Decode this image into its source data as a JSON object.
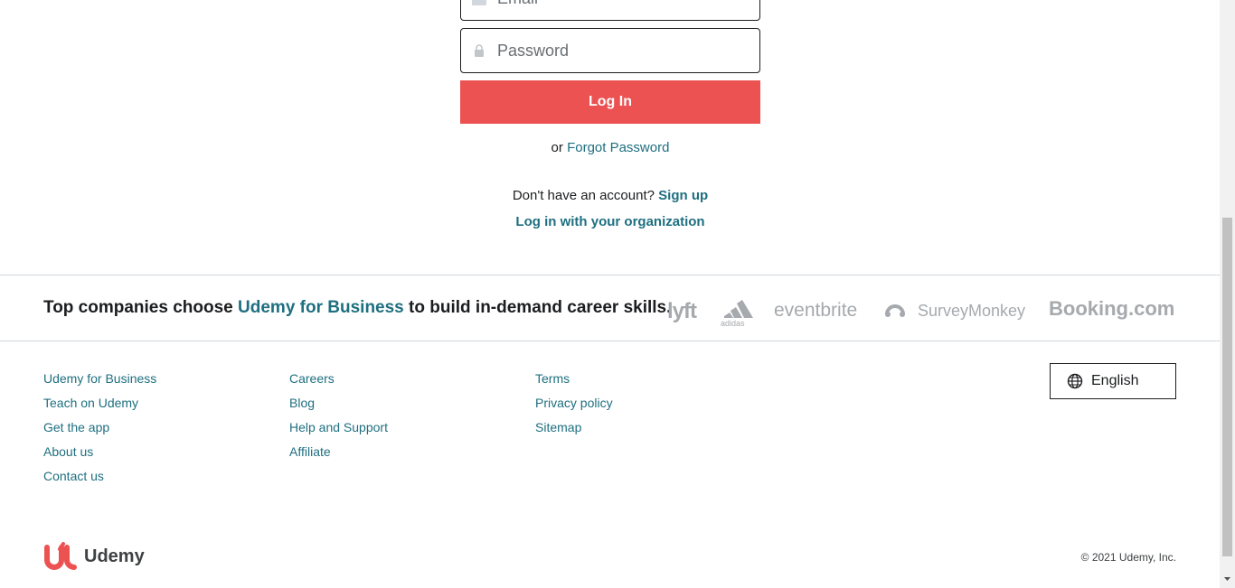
{
  "form": {
    "email_placeholder": "Email",
    "password_placeholder": "Password",
    "login_label": "Log In",
    "or_text": "or",
    "forgot_label": "Forgot Password",
    "no_account_text": "Don't have an account?",
    "signup_label": "Sign up",
    "org_login_label": "Log in with your organization",
    "icons": [
      "mail-icon",
      "lock-icon"
    ]
  },
  "business": {
    "text_before": "Top companies choose",
    "link_label": "Udemy for Business",
    "text_after": "to build in-demand career skills.",
    "logos": [
      "lyft",
      "adidas",
      "eventbrite",
      "SurveyMonkey",
      "Booking.com"
    ]
  },
  "footer": {
    "col1": [
      "Udemy for Business",
      "Teach on Udemy",
      "Get the app",
      "About us",
      "Contact us"
    ],
    "col2": [
      "Careers",
      "Blog",
      "Help and Support",
      "Affiliate"
    ],
    "col3": [
      "Terms",
      "Privacy policy",
      "Sitemap"
    ],
    "language_label": "English",
    "brand_name": "Udemy",
    "copyright": "© 2021 Udemy, Inc."
  },
  "colors": {
    "accent": "#ec5252",
    "link": "#1e6f80",
    "text": "#1c1d1f",
    "logo_gray": "#a6a9ad"
  }
}
